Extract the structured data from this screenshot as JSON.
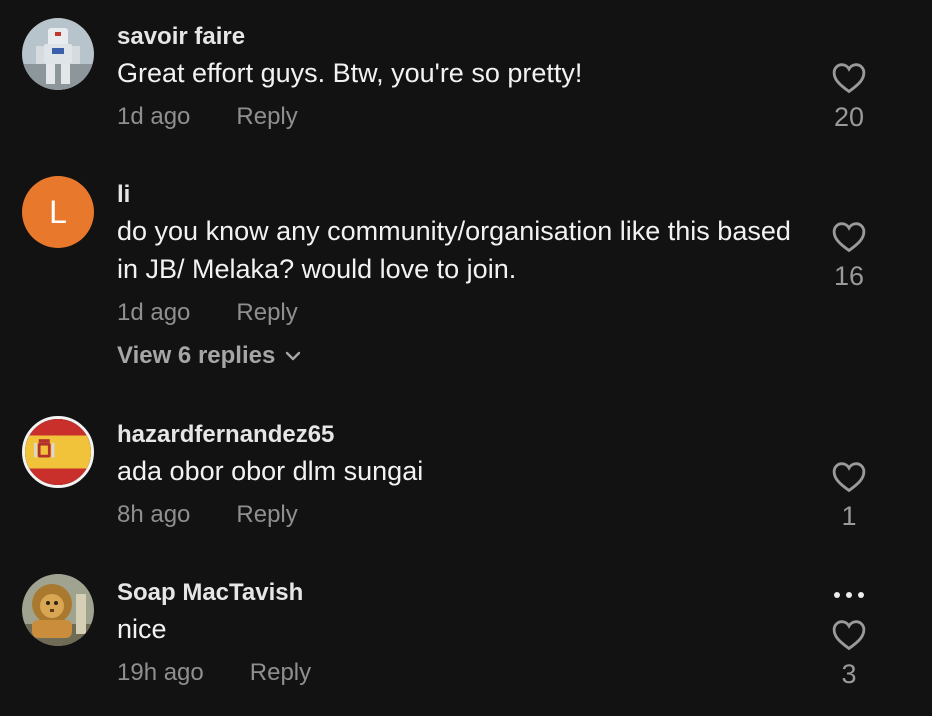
{
  "comments": [
    {
      "username": "savoir faire",
      "text": "Great effort guys. Btw, you're so pretty!",
      "time": "1d ago",
      "reply_label": "Reply",
      "likes": "20",
      "avatar": "robot-statue-photo"
    },
    {
      "username": "li",
      "text": "do you know any community/organisation like this based in JB/ Melaka? would love to join.",
      "time": "1d ago",
      "reply_label": "Reply",
      "likes": "16",
      "avatar_letter": "L",
      "view_replies": "View 6 replies"
    },
    {
      "username": "hazardfernandez65",
      "text": "ada obor obor dlm sungai",
      "time": "8h ago",
      "reply_label": "Reply",
      "likes": "1",
      "avatar": "spain-flag"
    },
    {
      "username": "Soap MacTavish",
      "text": "nice",
      "time": "19h ago",
      "reply_label": "Reply",
      "likes": "3",
      "avatar": "lion-art-photo"
    }
  ],
  "icons": {
    "like": "heart-outline-icon",
    "expand": "chevron-down-icon",
    "more": "more-dots-icon"
  },
  "colors": {
    "background": "#121212",
    "letter_avatar": "#e8792c"
  }
}
